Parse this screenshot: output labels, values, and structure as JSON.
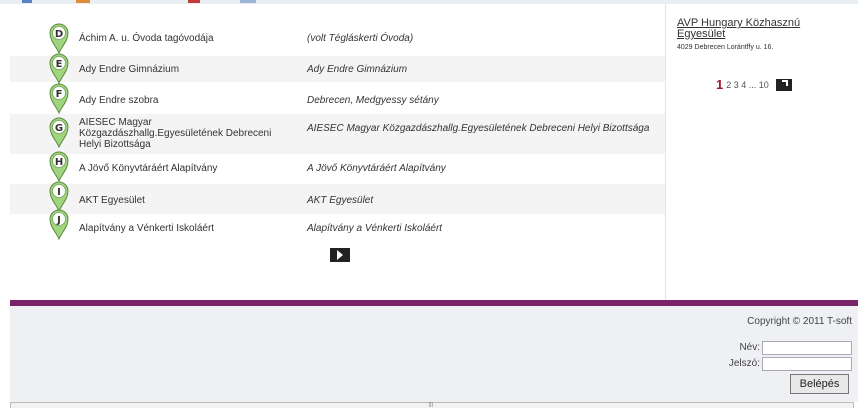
{
  "listing": {
    "rows": [
      {
        "letter": "D",
        "name": "Áchim A. u. Óvoda tagóvodája",
        "link": "(volt Tégláskerti Óvoda)"
      },
      {
        "letter": "E",
        "name": "Ady Endre Gimnázium",
        "link": "Ady Endre Gimnázium"
      },
      {
        "letter": "F",
        "name": "Ady Endre szobra",
        "link": "Debrecen, Medgyessy sétány"
      },
      {
        "letter": "G",
        "name": "AIESEC Magyar Közgazdászhallg.Egyesületének Debreceni Helyi Bizottsága",
        "link": "AIESEC Magyar Közgazdászhallg.Egyesületének Debreceni Helyi Bizottsága"
      },
      {
        "letter": "H",
        "name": "A Jövő Könyvtáráért Alapítvány",
        "link": "A Jövő Könyvtáráért Alapítvány"
      },
      {
        "letter": "I",
        "name": "AKT Egyesület",
        "link": "AKT Egyesület"
      },
      {
        "letter": "J",
        "name": "Alapítvány a Vénkerti Iskoláért",
        "link": "Alapítvány a Vénkerti Iskoláért"
      }
    ],
    "next_icon": "next-arrow-icon"
  },
  "sidebar": {
    "org_name": "AVP Hungary Közhasznú Egyesület",
    "org_address": "4029 Debrecen Lorántffy u. 16.",
    "pager": {
      "current": "1",
      "pages": "2 3 4 ... 10",
      "next_icon": "next-arrow-icon"
    }
  },
  "footer": {
    "copyright": "Copyright © 2011 T-soft",
    "name_label": "Név:",
    "password_label": "Jelszó:",
    "login_button": "Belépés"
  },
  "colors": {
    "accent_purple": "#7b2369",
    "pin_green": "#9fd57f",
    "pager_current": "#a0192b"
  }
}
